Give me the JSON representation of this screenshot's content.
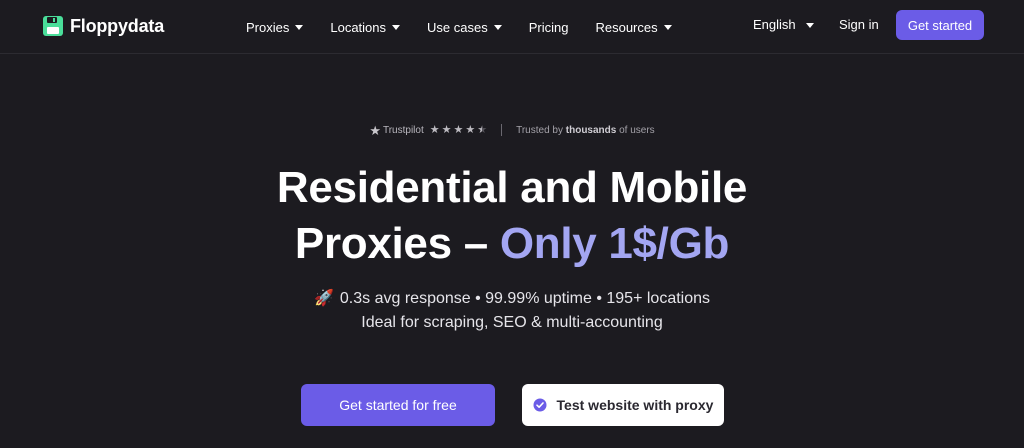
{
  "brand": {
    "name": "Floppydata",
    "icon": "floppy-disk-icon",
    "icon_color": "#4ade9a"
  },
  "nav": {
    "items": [
      {
        "label": "Proxies",
        "has_dropdown": true
      },
      {
        "label": "Locations",
        "has_dropdown": true
      },
      {
        "label": "Use cases",
        "has_dropdown": true
      },
      {
        "label": "Pricing",
        "has_dropdown": false
      },
      {
        "label": "Resources",
        "has_dropdown": true
      }
    ],
    "language": "English",
    "signin": "Sign in",
    "cta": "Get started"
  },
  "trust": {
    "brand": "Trustpilot",
    "rating_stars": 4.5,
    "text_prefix": "Trusted by",
    "text_bold": "thousands",
    "text_suffix": "of users"
  },
  "hero": {
    "headline_line1": "Residential and Mobile",
    "headline_line2_start": "Proxies –",
    "headline_accent": "Only 1$/Gb",
    "sub_icon": "rocket-emoji",
    "subline1": "0.3s avg response • 99.99% uptime • 195+ locations",
    "subline2": "Ideal for scraping, SEO & multi-accounting",
    "cta_primary": "Get started for free",
    "cta_secondary": "Test website with proxy"
  },
  "colors": {
    "background": "#1c1b20",
    "accent": "#6b5ce7",
    "headline_accent": "#a3a6f2"
  }
}
